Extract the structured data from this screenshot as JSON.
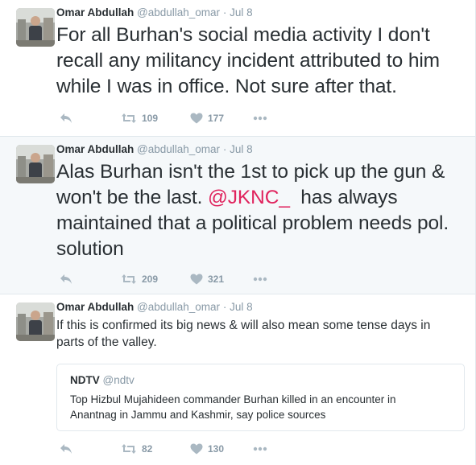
{
  "colors": {
    "name": "#292f33",
    "meta": "#8899a6",
    "mention": "#e0245e",
    "highlight_bg": "#f5f8fa",
    "border": "#e1e8ed"
  },
  "tweets": [
    {
      "name": "Omar Abdullah",
      "handle": "@abdullah_omar",
      "separator": "·",
      "time": "Jul 8",
      "text": "For all Burhan's social media activity I don't recall any militancy incident attributed to him while I was in office. Not sure after that.",
      "retweets": "109",
      "likes": "177"
    },
    {
      "name": "Omar Abdullah",
      "handle": "@abdullah_omar",
      "separator": "·",
      "time": "Jul 8",
      "text_before": "Alas Burhan isn't the 1st to pick up the gun & won't be the last. ",
      "mention": "@JKNC_",
      "text_after": "  has always maintained that a political problem needs pol. solution",
      "retweets": "209",
      "likes": "321"
    },
    {
      "name": "Omar Abdullah",
      "handle": "@abdullah_omar",
      "separator": "·",
      "time": "Jul 8",
      "text": "If this is confirmed its big news & will also mean some tense days in parts of the valley.",
      "quote": {
        "name": "NDTV",
        "handle": "@ndtv",
        "text": "Top Hizbul Mujahideen commander Burhan killed in an encounter in Anantnag in Jammu and Kashmir, say police sources"
      },
      "retweets": "82",
      "likes": "130"
    }
  ],
  "icons": {
    "reply": "reply-icon",
    "retweet": "retweet-icon",
    "like": "heart-icon",
    "more": "more-icon"
  }
}
